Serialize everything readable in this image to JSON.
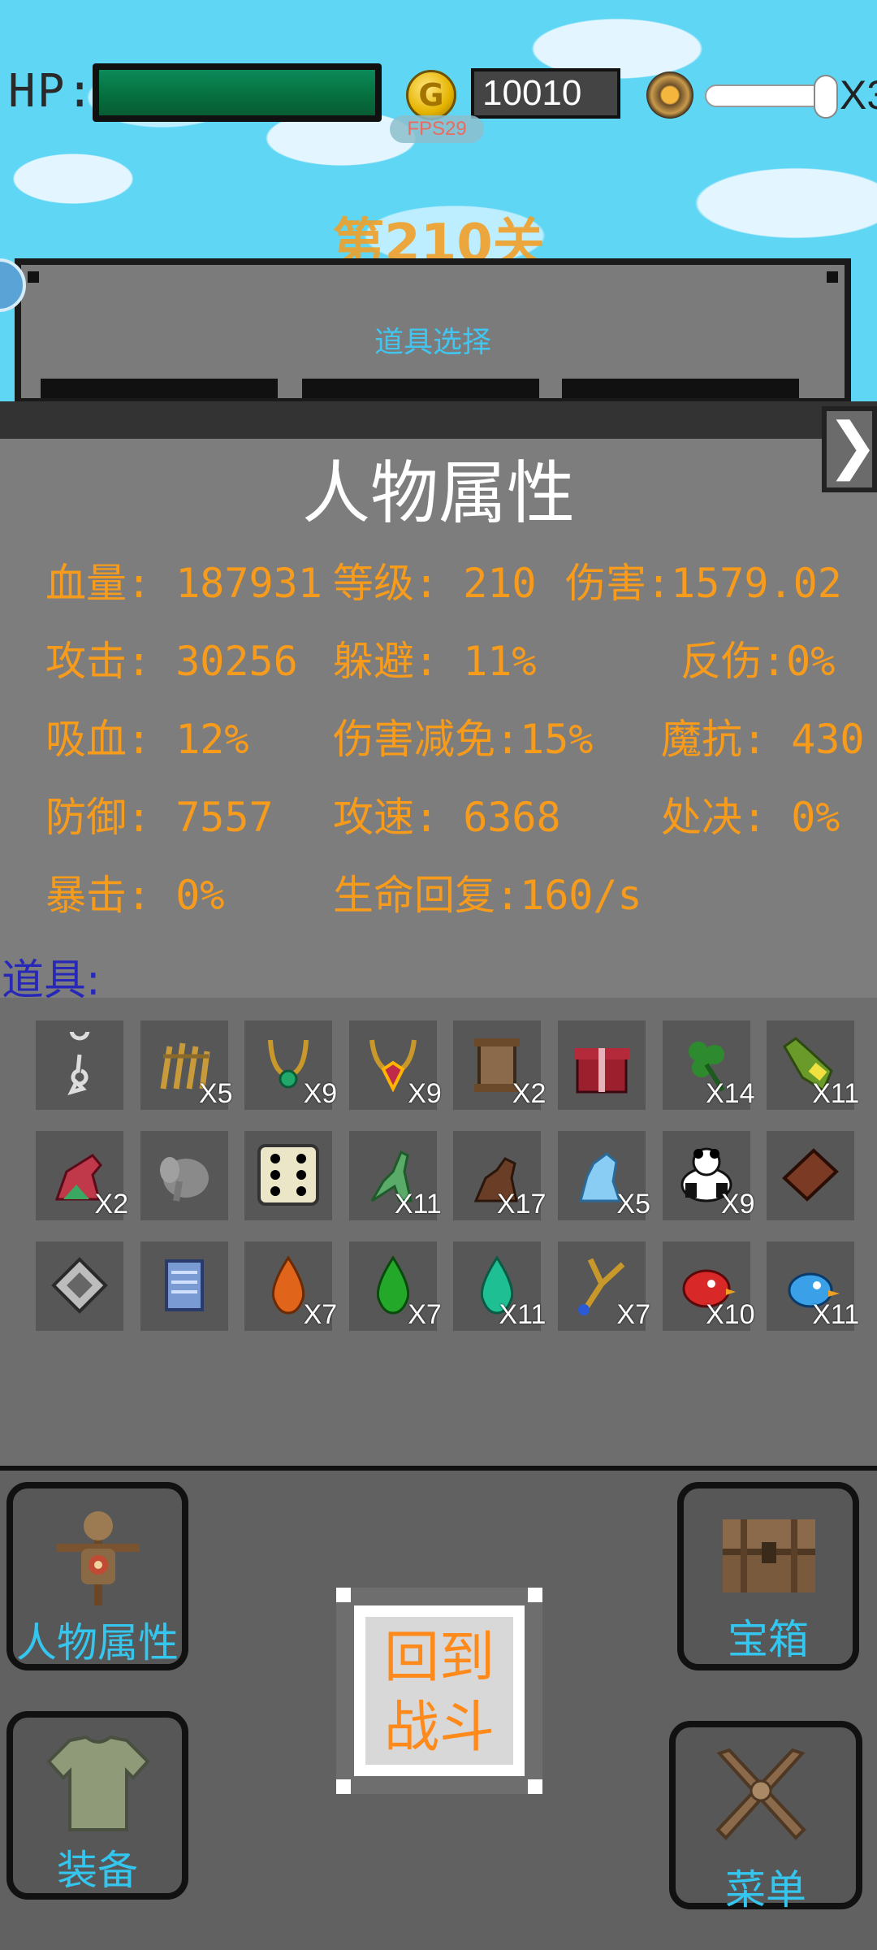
{
  "hud": {
    "hp_label": "HP:",
    "hp_percent": 100,
    "coin_symbol": "G",
    "gold": "10010",
    "fps": "FPS29",
    "speed": "X3"
  },
  "level_title": "第210关",
  "item_select": {
    "title": "道具选择"
  },
  "attributes": {
    "title": "人物属性",
    "close_symbol": "❯",
    "stats": [
      "血量: 187931",
      "等级: 210",
      "伤害:1579.02",
      "攻击: 30256",
      "躲避: 11%",
      "反伤:0%",
      "吸血: 12%",
      "伤害减免:15%",
      "魔抗: 430",
      "防御: 7557",
      "攻速: 6368",
      "处决: 0%",
      "暴击: 0%",
      "生命回复:160/s"
    ]
  },
  "items": {
    "label": "道具:",
    "slots": [
      {
        "icon": "chain-icon",
        "count": ""
      },
      {
        "icon": "golden-claw-icon",
        "count": "X5"
      },
      {
        "icon": "green-gem-necklace-icon",
        "count": "X9"
      },
      {
        "icon": "red-gem-necklace-icon",
        "count": "X9"
      },
      {
        "icon": "scroll-icon",
        "count": "X2"
      },
      {
        "icon": "gift-box-icon",
        "count": ""
      },
      {
        "icon": "clover-icon",
        "count": "X14"
      },
      {
        "icon": "bottle-icon",
        "count": "X11"
      },
      {
        "icon": "red-dino-icon",
        "count": "X2"
      },
      {
        "icon": "elephant-icon",
        "count": ""
      },
      {
        "icon": "dice-icon",
        "count": ""
      },
      {
        "icon": "green-kangaroo-icon",
        "count": "X11"
      },
      {
        "icon": "brown-bear-icon",
        "count": "X17"
      },
      {
        "icon": "ice-bear-icon",
        "count": "X5"
      },
      {
        "icon": "panda-icon",
        "count": "X9"
      },
      {
        "icon": "book-icon",
        "count": ""
      },
      {
        "icon": "card-pack-icon",
        "count": ""
      },
      {
        "icon": "blue-scroll-icon",
        "count": ""
      },
      {
        "icon": "orange-drop-icon",
        "count": "X7"
      },
      {
        "icon": "green-drop-icon",
        "count": "X7"
      },
      {
        "icon": "teal-drop-icon",
        "count": "X11"
      },
      {
        "icon": "slingshot-icon",
        "count": "X7"
      },
      {
        "icon": "red-bird-icon",
        "count": "X10"
      },
      {
        "icon": "blue-bird-icon",
        "count": "X11"
      }
    ]
  },
  "nav": {
    "attributes_label": "人物属性",
    "chest_label": "宝箱",
    "equipment_label": "装备",
    "menu_label": "菜单",
    "back_line1": "回到",
    "back_line2": "战斗"
  }
}
